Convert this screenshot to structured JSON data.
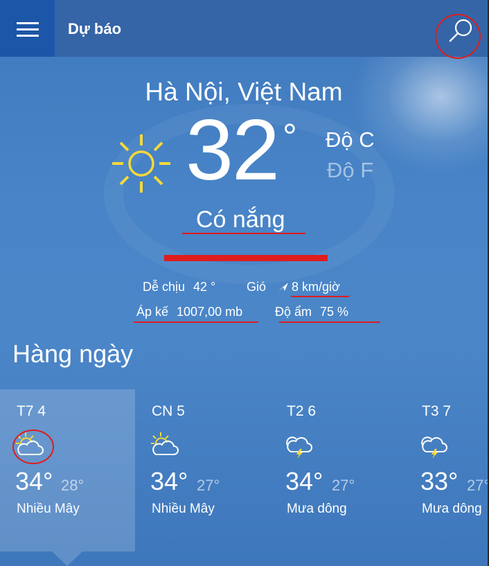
{
  "header": {
    "title": "Dự báo",
    "menu_icon": "hamburger-menu-icon",
    "search_icon": "search-icon"
  },
  "current": {
    "location": "Hà Nội, Việt Nam",
    "icon": "sun-icon",
    "temperature": "32",
    "degree_symbol": "°",
    "unit_c": "Độ C",
    "unit_f": "Độ F",
    "condition": "Có nắng",
    "details": {
      "feels_like_label": "Dễ chịu",
      "feels_like_value": "42 °",
      "wind_label": "Gió",
      "wind_icon": "wind-direction-arrow-icon",
      "wind_value": "8 km/giờ",
      "pressure_label": "Áp kế",
      "pressure_value": "1007,00 mb",
      "humidity_label": "Độ ẩm",
      "humidity_value": "75 %"
    }
  },
  "daily": {
    "title": "Hàng ngày",
    "days": [
      {
        "label": "T7 4",
        "icon": "partly-sunny-icon",
        "high": "34°",
        "low": "28°",
        "condition": "Nhiều Mây"
      },
      {
        "label": "CN 5",
        "icon": "partly-sunny-icon",
        "high": "34°",
        "low": "27°",
        "condition": "Nhiều Mây"
      },
      {
        "label": "T2 6",
        "icon": "thunderstorm-icon",
        "high": "34°",
        "low": "27°",
        "condition": "Mưa dông"
      },
      {
        "label": "T3 7",
        "icon": "thunderstorm-icon",
        "high": "33°",
        "low": "27°",
        "condition": "Mưa dông"
      }
    ]
  },
  "colors": {
    "header_bg": "#3565a6",
    "menu_bg": "#1c56a8",
    "sun_yellow": "#f5d93a",
    "annotation_red": "#e01c1c"
  }
}
